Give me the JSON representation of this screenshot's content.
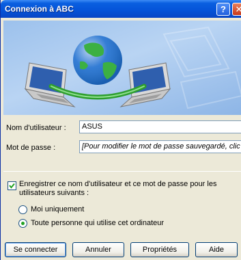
{
  "window": {
    "title": "Connexion à ABC",
    "help_glyph": "?",
    "close_glyph": "✕"
  },
  "form": {
    "username_label": "Nom d'utilisateur :",
    "username_value": "ASUS",
    "password_label": "Mot de passe :",
    "password_value": "[Pour modifier le mot de passe sauvegardé, clic",
    "save_checkbox_label": "Enregistrer ce nom d'utilisateur et ce mot de passe pour les utilisateurs suivants :",
    "save_checked": true,
    "radio_me_only": "Moi uniquement",
    "radio_anyone": "Toute personne qui utilise cet ordinateur",
    "selected_radio": "anyone"
  },
  "buttons": {
    "connect": "Se connecter",
    "cancel": "Annuler",
    "properties": "Propriétés",
    "help": "Aide"
  },
  "icons": [
    "help-icon",
    "close-icon",
    "network-globe-icon",
    "laptop-icon",
    "checkmark-icon"
  ],
  "colors": {
    "titlebar": "#0553d8",
    "dialog_bg": "#ece9d8",
    "close_btn": "#c8391a",
    "banner": "#9cc1ec"
  }
}
